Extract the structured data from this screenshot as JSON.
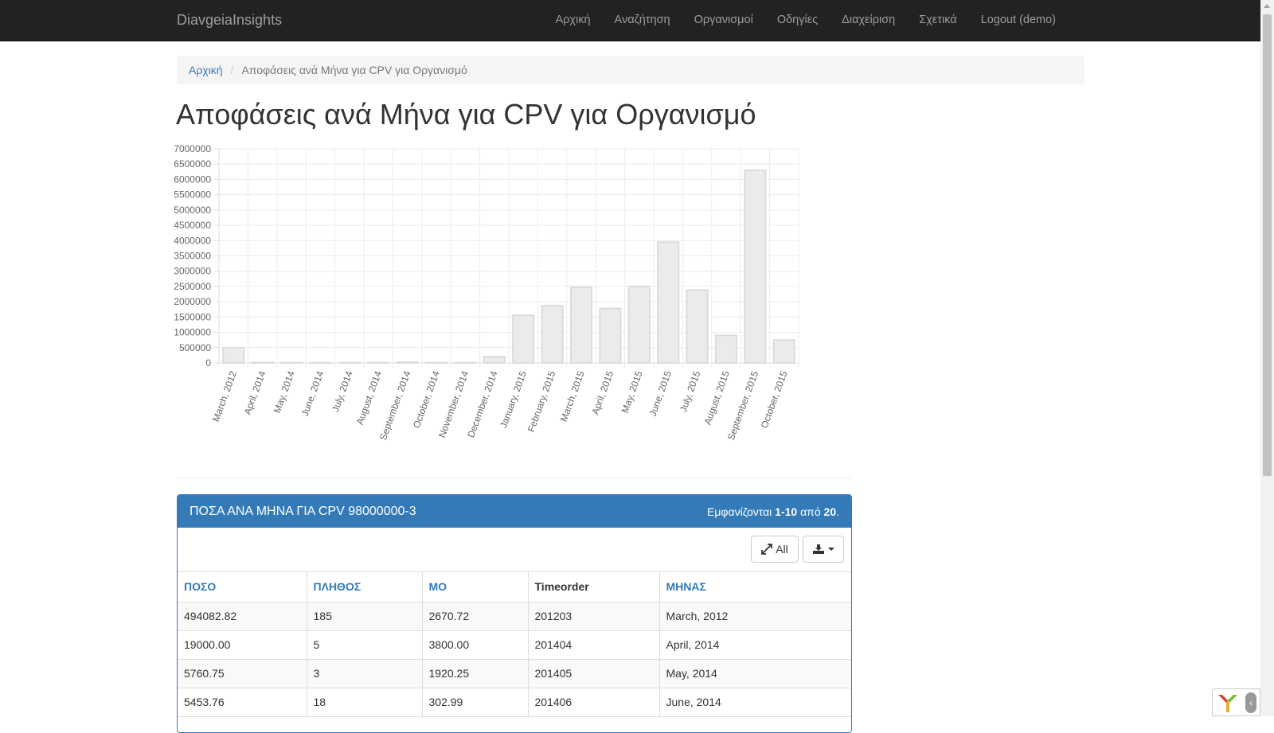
{
  "navbar": {
    "brand": "DiavgeiaInsights",
    "items": [
      "Αρχική",
      "Αναζήτηση",
      "Οργανισμοί",
      "Οδηγίες",
      "Διαχείριση",
      "Σχετικά",
      "Logout (demo)"
    ]
  },
  "breadcrumb": {
    "home": "Αρχική",
    "separator": "/",
    "current": "Αποφάσεις ανά Μήνα για CPV για Οργανισμό"
  },
  "page_title": "Αποφάσεις ανά Μήνα για CPV για Οργανισμό",
  "chart_data": {
    "type": "bar",
    "categories": [
      "March, 2012",
      "April, 2014",
      "May, 2014",
      "June, 2014",
      "July, 2014",
      "August, 2014",
      "September, 2014",
      "October, 2014",
      "November, 2014",
      "December, 2014",
      "January, 2015",
      "February, 2015",
      "March, 2015",
      "April, 2015",
      "May, 2015",
      "June, 2015",
      "July, 2015",
      "August, 2015",
      "September, 2015",
      "October, 2015"
    ],
    "values": [
      494082.82,
      19000,
      5760.75,
      5453.76,
      8000,
      9000,
      25000,
      7000,
      6000,
      200000,
      1560000,
      1870000,
      2480000,
      1780000,
      2500000,
      3950000,
      2380000,
      900000,
      6300000,
      750000
    ],
    "ylim": [
      0,
      7000000
    ],
    "yticks": [
      "0",
      "500000",
      "1000000",
      "1500000",
      "2000000",
      "2500000",
      "3000000",
      "3500000",
      "4000000",
      "4500000",
      "5000000",
      "5500000",
      "6000000",
      "6500000",
      "7000000"
    ],
    "grid": true,
    "bar_color": "#ebebeb",
    "bar_border": "#dcdcdc"
  },
  "panel": {
    "title": "ΠΟΣΑ ΑΝΑ ΜΗΝΑ ΓΙΑ CPV 98000000-3",
    "summary_prefix": "Εμφανίζονται ",
    "summary_range": "1-10",
    "summary_mid": " από ",
    "summary_total": "20",
    "summary_suffix": ".",
    "all_button": "All",
    "expand_icon": "expand-arrows-icon",
    "export_icon": "export-icon",
    "columns": [
      "ΠΟΣΟ",
      "ΠΛΗΘΟΣ",
      "ΜΟ",
      "Timeorder",
      "ΜΗΝΑΣ"
    ],
    "rows": [
      [
        "494082.82",
        "185",
        "2670.72",
        "201203",
        "March, 2012"
      ],
      [
        "19000.00",
        "5",
        "3800.00",
        "201404",
        "April, 2014"
      ],
      [
        "5760.75",
        "3",
        "1920.25",
        "201405",
        "May, 2014"
      ],
      [
        "5453.76",
        "18",
        "302.99",
        "201406",
        "June, 2014"
      ]
    ]
  },
  "colors": {
    "navbar": "#222222",
    "primary": "#337ab7"
  }
}
